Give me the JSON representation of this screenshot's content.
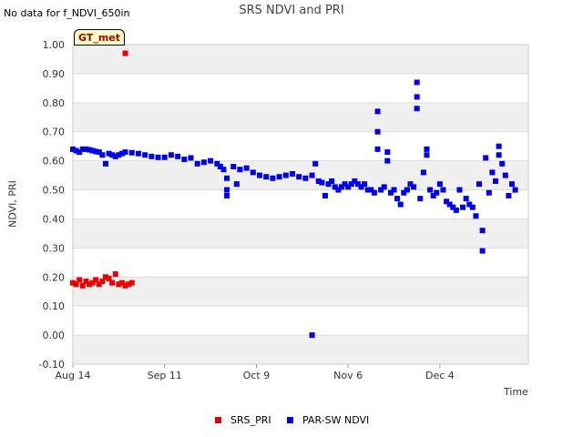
{
  "header": {
    "no_data_text": "No data for f_NDVI_650in",
    "badge_label": "GT_met"
  },
  "colors": {
    "srs_pri": "#ee0000",
    "par_sw_ndvi": "#0000ee",
    "band": "#f0f0f0",
    "grid": "#dddddd"
  },
  "chart_data": {
    "type": "scatter",
    "title": "SRS NDVI and PRI",
    "xlabel": "Time",
    "ylabel": "NDVI, PRI",
    "ylim": [
      -0.1,
      1.0
    ],
    "xlim": [
      "2023-08-14",
      "2023-12-31"
    ],
    "yticks": [
      "-0.10",
      "0.00",
      "0.10",
      "0.20",
      "0.30",
      "0.40",
      "0.50",
      "0.60",
      "0.70",
      "0.80",
      "0.90",
      "1.00"
    ],
    "xticks": [
      {
        "date": "2023-08-14",
        "label": "Aug 14"
      },
      {
        "date": "2023-09-11",
        "label": "Sep 11"
      },
      {
        "date": "2023-10-09",
        "label": "Oct 9"
      },
      {
        "date": "2023-11-06",
        "label": "Nov 6"
      },
      {
        "date": "2023-12-04",
        "label": "Dec 4"
      }
    ],
    "grid": true,
    "legend_position": "bottom",
    "series": [
      {
        "name": "SRS_PRI",
        "color": "#ee0000",
        "points": [
          [
            "2023-08-14",
            0.18
          ],
          [
            "2023-08-15",
            0.175
          ],
          [
            "2023-08-16",
            0.19
          ],
          [
            "2023-08-17",
            0.17
          ],
          [
            "2023-08-18",
            0.185
          ],
          [
            "2023-08-19",
            0.175
          ],
          [
            "2023-08-20",
            0.18
          ],
          [
            "2023-08-21",
            0.19
          ],
          [
            "2023-08-22",
            0.175
          ],
          [
            "2023-08-23",
            0.185
          ],
          [
            "2023-08-24",
            0.2
          ],
          [
            "2023-08-25",
            0.195
          ],
          [
            "2023-08-26",
            0.18
          ],
          [
            "2023-08-27",
            0.21
          ],
          [
            "2023-08-28",
            0.175
          ],
          [
            "2023-08-29",
            0.18
          ],
          [
            "2023-08-30",
            0.17
          ],
          [
            "2023-08-31",
            0.175
          ],
          [
            "2023-09-01",
            0.18
          ],
          [
            "2023-08-30",
            0.97
          ]
        ]
      },
      {
        "name": "PAR-SW NDVI",
        "color": "#0000ee",
        "points": [
          [
            "2023-08-14",
            0.64
          ],
          [
            "2023-08-15",
            0.635
          ],
          [
            "2023-08-16",
            0.63
          ],
          [
            "2023-08-17",
            0.64
          ],
          [
            "2023-08-18",
            0.64
          ],
          [
            "2023-08-19",
            0.638
          ],
          [
            "2023-08-20",
            0.635
          ],
          [
            "2023-08-21",
            0.632
          ],
          [
            "2023-08-22",
            0.63
          ],
          [
            "2023-08-23",
            0.62
          ],
          [
            "2023-08-24",
            0.59
          ],
          [
            "2023-08-25",
            0.625
          ],
          [
            "2023-08-26",
            0.62
          ],
          [
            "2023-08-27",
            0.615
          ],
          [
            "2023-08-28",
            0.62
          ],
          [
            "2023-08-29",
            0.625
          ],
          [
            "2023-08-30",
            0.63
          ],
          [
            "2023-09-01",
            0.628
          ],
          [
            "2023-09-03",
            0.625
          ],
          [
            "2023-09-05",
            0.62
          ],
          [
            "2023-09-07",
            0.615
          ],
          [
            "2023-09-09",
            0.612
          ],
          [
            "2023-09-11",
            0.612
          ],
          [
            "2023-09-13",
            0.62
          ],
          [
            "2023-09-15",
            0.615
          ],
          [
            "2023-09-17",
            0.605
          ],
          [
            "2023-09-19",
            0.61
          ],
          [
            "2023-09-21",
            0.59
          ],
          [
            "2023-09-23",
            0.595
          ],
          [
            "2023-09-25",
            0.6
          ],
          [
            "2023-09-27",
            0.59
          ],
          [
            "2023-09-28",
            0.58
          ],
          [
            "2023-09-29",
            0.57
          ],
          [
            "2023-09-30",
            0.54
          ],
          [
            "2023-09-30",
            0.5
          ],
          [
            "2023-09-30",
            0.48
          ],
          [
            "2023-10-02",
            0.58
          ],
          [
            "2023-10-03",
            0.52
          ],
          [
            "2023-10-04",
            0.57
          ],
          [
            "2023-10-06",
            0.575
          ],
          [
            "2023-10-08",
            0.56
          ],
          [
            "2023-10-10",
            0.55
          ],
          [
            "2023-10-12",
            0.545
          ],
          [
            "2023-10-14",
            0.54
          ],
          [
            "2023-10-16",
            0.545
          ],
          [
            "2023-10-18",
            0.55
          ],
          [
            "2023-10-20",
            0.555
          ],
          [
            "2023-10-22",
            0.545
          ],
          [
            "2023-10-24",
            0.54
          ],
          [
            "2023-10-26",
            0.55
          ],
          [
            "2023-10-27",
            0.59
          ],
          [
            "2023-10-26",
            0.0
          ],
          [
            "2023-10-28",
            0.53
          ],
          [
            "2023-10-29",
            0.525
          ],
          [
            "2023-10-30",
            0.48
          ],
          [
            "2023-10-31",
            0.52
          ],
          [
            "2023-11-01",
            0.53
          ],
          [
            "2023-11-02",
            0.51
          ],
          [
            "2023-11-03",
            0.5
          ],
          [
            "2023-11-04",
            0.51
          ],
          [
            "2023-11-05",
            0.52
          ],
          [
            "2023-11-06",
            0.51
          ],
          [
            "2023-11-07",
            0.52
          ],
          [
            "2023-11-08",
            0.53
          ],
          [
            "2023-11-09",
            0.52
          ],
          [
            "2023-11-10",
            0.51
          ],
          [
            "2023-11-11",
            0.52
          ],
          [
            "2023-11-12",
            0.5
          ],
          [
            "2023-11-13",
            0.5
          ],
          [
            "2023-11-14",
            0.49
          ],
          [
            "2023-11-15",
            0.77
          ],
          [
            "2023-11-15",
            0.7
          ],
          [
            "2023-11-15",
            0.64
          ],
          [
            "2023-11-16",
            0.5
          ],
          [
            "2023-11-17",
            0.51
          ],
          [
            "2023-11-18",
            0.63
          ],
          [
            "2023-11-18",
            0.6
          ],
          [
            "2023-11-19",
            0.49
          ],
          [
            "2023-11-20",
            0.5
          ],
          [
            "2023-11-21",
            0.47
          ],
          [
            "2023-11-22",
            0.45
          ],
          [
            "2023-11-23",
            0.49
          ],
          [
            "2023-11-24",
            0.5
          ],
          [
            "2023-11-25",
            0.52
          ],
          [
            "2023-11-26",
            0.51
          ],
          [
            "2023-11-27",
            0.87
          ],
          [
            "2023-11-27",
            0.82
          ],
          [
            "2023-11-27",
            0.78
          ],
          [
            "2023-11-28",
            0.47
          ],
          [
            "2023-11-29",
            0.56
          ],
          [
            "2023-11-30",
            0.62
          ],
          [
            "2023-11-30",
            0.64
          ],
          [
            "2023-12-01",
            0.5
          ],
          [
            "2023-12-02",
            0.48
          ],
          [
            "2023-12-03",
            0.49
          ],
          [
            "2023-12-04",
            0.52
          ],
          [
            "2023-12-05",
            0.5
          ],
          [
            "2023-12-06",
            0.46
          ],
          [
            "2023-12-07",
            0.45
          ],
          [
            "2023-12-08",
            0.44
          ],
          [
            "2023-12-09",
            0.43
          ],
          [
            "2023-12-10",
            0.5
          ],
          [
            "2023-12-11",
            0.44
          ],
          [
            "2023-12-12",
            0.47
          ],
          [
            "2023-12-13",
            0.45
          ],
          [
            "2023-12-14",
            0.44
          ],
          [
            "2023-12-15",
            0.41
          ],
          [
            "2023-12-16",
            0.52
          ],
          [
            "2023-12-17",
            0.36
          ],
          [
            "2023-12-17",
            0.29
          ],
          [
            "2023-12-18",
            0.61
          ],
          [
            "2023-12-19",
            0.49
          ],
          [
            "2023-12-20",
            0.56
          ],
          [
            "2023-12-21",
            0.53
          ],
          [
            "2023-12-22",
            0.65
          ],
          [
            "2023-12-22",
            0.62
          ],
          [
            "2023-12-23",
            0.59
          ],
          [
            "2023-12-24",
            0.55
          ],
          [
            "2023-12-25",
            0.48
          ],
          [
            "2023-12-26",
            0.52
          ],
          [
            "2023-12-27",
            0.5
          ]
        ]
      }
    ]
  }
}
